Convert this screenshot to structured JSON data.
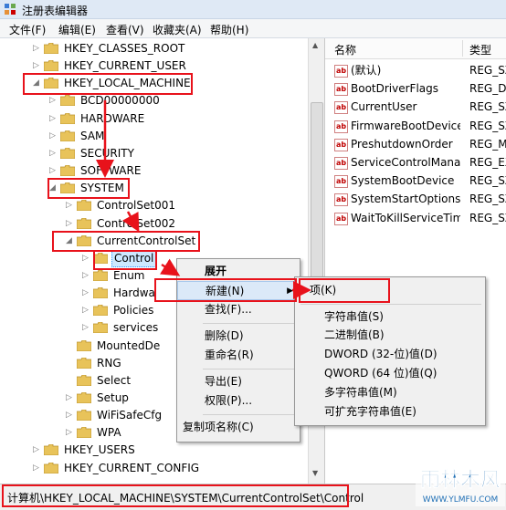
{
  "window": {
    "title": "注册表编辑器"
  },
  "menu": [
    "文件(F)",
    "编辑(E)",
    "查看(V)",
    "收藏夹(A)",
    "帮助(H)"
  ],
  "tree": [
    {
      "label": "HKEY_CLASSES_ROOT"
    },
    {
      "label": "HKEY_CURRENT_USER"
    },
    {
      "label": "HKEY_LOCAL_MACHINE"
    },
    {
      "label": "BCD00000000"
    },
    {
      "label": "HARDWARE"
    },
    {
      "label": "SAM"
    },
    {
      "label": "SECURITY"
    },
    {
      "label": "SOFTWARE"
    },
    {
      "label": "SYSTEM"
    },
    {
      "label": "ControlSet001"
    },
    {
      "label": "ControlSet002"
    },
    {
      "label": "CurrentControlSet"
    },
    {
      "label": "Control"
    },
    {
      "label": "Enum"
    },
    {
      "label": "Hardwa"
    },
    {
      "label": "Policies"
    },
    {
      "label": "services"
    },
    {
      "label": "MountedDe"
    },
    {
      "label": "RNG"
    },
    {
      "label": "Select"
    },
    {
      "label": "Setup"
    },
    {
      "label": "WiFiSafeCfg"
    },
    {
      "label": "WPA"
    },
    {
      "label": "HKEY_USERS"
    },
    {
      "label": "HKEY_CURRENT_CONFIG"
    }
  ],
  "list": {
    "col_name": "名称",
    "col_type": "类型",
    "rows": [
      {
        "name": "(默认)",
        "type": "REG_SZ"
      },
      {
        "name": "BootDriverFlags",
        "type": "REG_DW"
      },
      {
        "name": "CurrentUser",
        "type": "REG_SZ"
      },
      {
        "name": "FirmwareBootDevice",
        "type": "REG_SZ"
      },
      {
        "name": "PreshutdownOrder",
        "type": "REG_M"
      },
      {
        "name": "ServiceControlMana...",
        "type": "REG_EX"
      },
      {
        "name": "SystemBootDevice",
        "type": "REG_SZ"
      },
      {
        "name": "SystemStartOptions",
        "type": "REG_SZ"
      },
      {
        "name": "WaitToKillServiceTim...",
        "type": "REG_SZ"
      }
    ],
    "icon_text": "ab"
  },
  "context_menu": {
    "expand": "展开",
    "new": "新建(N)",
    "find": "查找(F)...",
    "delete": "删除(D)",
    "rename": "重命名(R)",
    "export": "导出(E)",
    "permissions": "权限(P)...",
    "copy_key_name": "复制项名称(C)"
  },
  "submenu": {
    "key": "项(K)",
    "string": "字符串值(S)",
    "binary": "二进制值(B)",
    "dword": "DWORD (32-位)值(D)",
    "qword": "QWORD (64 位)值(Q)",
    "multi": "多字符串值(M)",
    "expand_string": "可扩充字符串值(E)"
  },
  "status": "计算机\\HKEY_LOCAL_MACHINE\\SYSTEM\\CurrentControlSet\\Control",
  "watermark": {
    "text": "雨林木风",
    "url": "WWW.YLMFU.COM"
  },
  "colors": {
    "highlight_box": "#e8121b",
    "folder": "#e8c35a",
    "selection": "#cde8ff"
  }
}
